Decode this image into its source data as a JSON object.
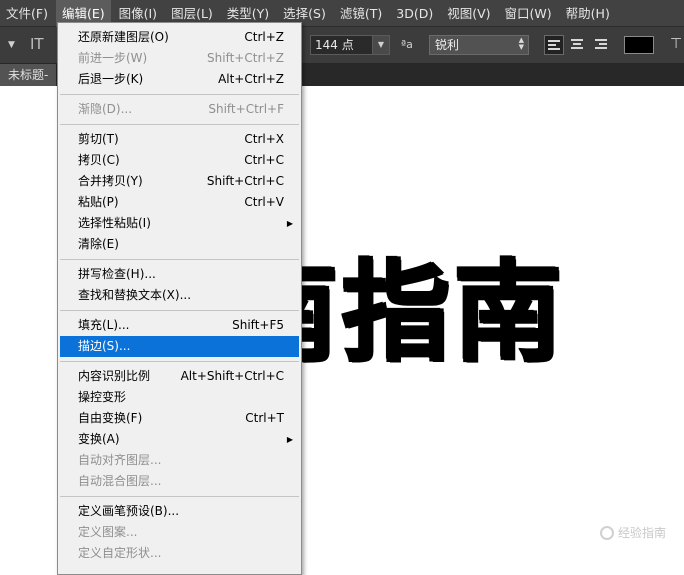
{
  "menubar": {
    "items": [
      {
        "label": "文件(F)",
        "active": false
      },
      {
        "label": "编辑(E)",
        "active": true
      },
      {
        "label": "图像(I)",
        "active": false
      },
      {
        "label": "图层(L)",
        "active": false
      },
      {
        "label": "类型(Y)",
        "active": false
      },
      {
        "label": "选择(S)",
        "active": false
      },
      {
        "label": "滤镜(T)",
        "active": false
      },
      {
        "label": "3D(D)",
        "active": false
      },
      {
        "label": "视图(V)",
        "active": false
      },
      {
        "label": "窗口(W)",
        "active": false
      },
      {
        "label": "帮助(H)",
        "active": false
      }
    ]
  },
  "options": {
    "font_size": "144 点",
    "aa_label": "ªa",
    "antialias": "锐利"
  },
  "document": {
    "tab_title": "未标题-"
  },
  "canvas": {
    "text": "南指南",
    "watermark": "经验指南"
  },
  "edit_menu": {
    "groups": [
      [
        {
          "label": "还原新建图层(O)",
          "shortcut": "Ctrl+Z",
          "enabled": true
        },
        {
          "label": "前进一步(W)",
          "shortcut": "Shift+Ctrl+Z",
          "enabled": false
        },
        {
          "label": "后退一步(K)",
          "shortcut": "Alt+Ctrl+Z",
          "enabled": true
        }
      ],
      [
        {
          "label": "渐隐(D)...",
          "shortcut": "Shift+Ctrl+F",
          "enabled": false
        }
      ],
      [
        {
          "label": "剪切(T)",
          "shortcut": "Ctrl+X",
          "enabled": true
        },
        {
          "label": "拷贝(C)",
          "shortcut": "Ctrl+C",
          "enabled": true
        },
        {
          "label": "合并拷贝(Y)",
          "shortcut": "Shift+Ctrl+C",
          "enabled": true
        },
        {
          "label": "粘贴(P)",
          "shortcut": "Ctrl+V",
          "enabled": true
        },
        {
          "label": "选择性粘贴(I)",
          "shortcut": "",
          "enabled": true,
          "submenu": true
        },
        {
          "label": "清除(E)",
          "shortcut": "",
          "enabled": true
        }
      ],
      [
        {
          "label": "拼写检查(H)...",
          "shortcut": "",
          "enabled": true
        },
        {
          "label": "查找和替换文本(X)...",
          "shortcut": "",
          "enabled": true
        }
      ],
      [
        {
          "label": "填充(L)...",
          "shortcut": "Shift+F5",
          "enabled": true
        },
        {
          "label": "描边(S)...",
          "shortcut": "",
          "enabled": true,
          "highlighted": true
        }
      ],
      [
        {
          "label": "内容识别比例",
          "shortcut": "Alt+Shift+Ctrl+C",
          "enabled": true
        },
        {
          "label": "操控变形",
          "shortcut": "",
          "enabled": true
        },
        {
          "label": "自由变换(F)",
          "shortcut": "Ctrl+T",
          "enabled": true
        },
        {
          "label": "变换(A)",
          "shortcut": "",
          "enabled": true,
          "submenu": true
        },
        {
          "label": "自动对齐图层...",
          "shortcut": "",
          "enabled": false
        },
        {
          "label": "自动混合图层...",
          "shortcut": "",
          "enabled": false
        }
      ],
      [
        {
          "label": "定义画笔预设(B)...",
          "shortcut": "",
          "enabled": true
        },
        {
          "label": "定义图案...",
          "shortcut": "",
          "enabled": false
        },
        {
          "label": "定义自定形状...",
          "shortcut": "",
          "enabled": false
        }
      ]
    ]
  },
  "icons": {
    "submenu_arrow": "triangle-right-icon",
    "text_tool": "text-orientation-icon",
    "dropdown_arrow": "chevron-down-icon"
  },
  "colors": {
    "highlight": "#0a72d9",
    "menubar_bg": "#424242",
    "text_color_swatch": "#000000"
  }
}
